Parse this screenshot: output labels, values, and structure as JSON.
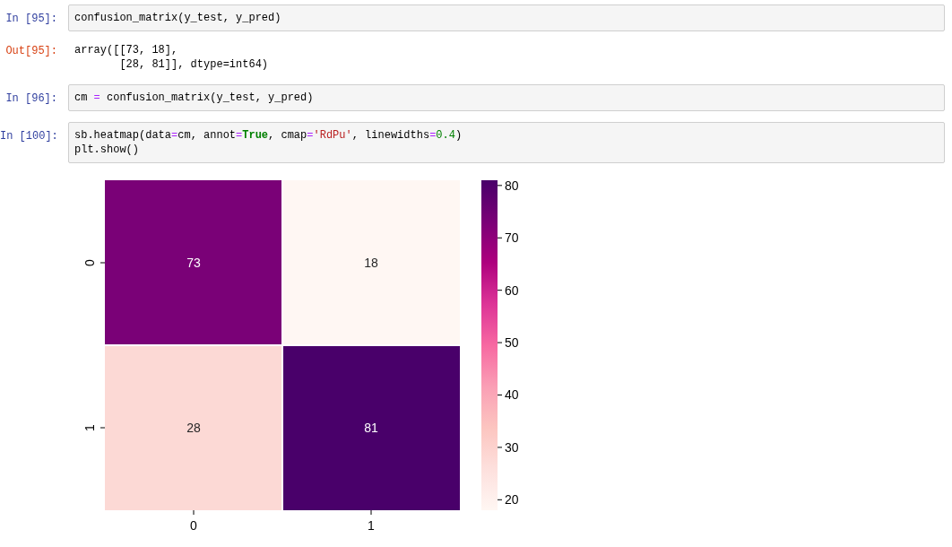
{
  "cells": [
    {
      "kind": "input",
      "prompt": "In [95]:",
      "lines": [
        [
          {
            "text": "confusion_matrix(y_test, y_pred)",
            "kind": "plain"
          }
        ]
      ]
    },
    {
      "kind": "output",
      "prompt": "Out[95]:",
      "lines": [
        "array([[73, 18],",
        "       [28, 81]], dtype=int64)"
      ]
    },
    {
      "kind": "input",
      "prompt": "In [96]:",
      "lines": [
        [
          {
            "text": "cm ",
            "kind": "plain"
          },
          {
            "text": "=",
            "kind": "operator"
          },
          {
            "text": " confusion_matrix(y_test, y_pred)",
            "kind": "plain"
          }
        ]
      ]
    },
    {
      "kind": "input",
      "prompt": "In [100]:",
      "lines": [
        [
          {
            "text": "sb.heatmap(data",
            "kind": "plain"
          },
          {
            "text": "=",
            "kind": "operator"
          },
          {
            "text": "cm, annot",
            "kind": "plain"
          },
          {
            "text": "=",
            "kind": "operator"
          },
          {
            "text": "True",
            "kind": "keyword"
          },
          {
            "text": ", cmap",
            "kind": "plain"
          },
          {
            "text": "=",
            "kind": "operator"
          },
          {
            "text": "'RdPu'",
            "kind": "string"
          },
          {
            "text": ", linewidths",
            "kind": "plain"
          },
          {
            "text": "=",
            "kind": "operator"
          },
          {
            "text": "0.4",
            "kind": "number"
          },
          {
            "text": ")",
            "kind": "plain"
          }
        ],
        [
          {
            "text": "plt.show()",
            "kind": "plain"
          }
        ]
      ]
    },
    {
      "kind": "figure",
      "heatmap": {
        "row_labels": [
          "0",
          "1"
        ],
        "column_labels": [
          "0",
          "1"
        ],
        "cells": [
          [
            {
              "value": "73",
              "color": "#7a0177"
            },
            {
              "value": "18",
              "color": "#fff7f3"
            }
          ],
          [
            {
              "value": "28",
              "color": "#fcd9d5"
            },
            {
              "value": "81",
              "color": "#49006a"
            }
          ]
        ],
        "colorbar_ticks": [
          "80",
          "70",
          "60",
          "50",
          "40",
          "30",
          "20"
        ]
      }
    }
  ]
}
